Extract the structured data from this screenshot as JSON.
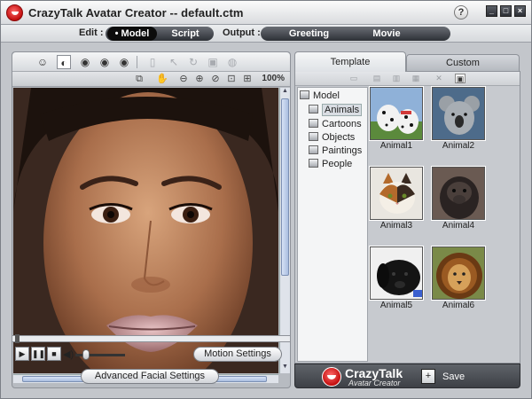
{
  "window": {
    "title": "CrazyTalk Avatar Creator -- default.ctm",
    "help": "?",
    "controls": [
      "_",
      "□",
      "×"
    ]
  },
  "modebar": {
    "edit_label": "Edit :",
    "output_label": "Output :",
    "edit_tabs": [
      "Model",
      "Script"
    ],
    "output_tabs": [
      "Greeting",
      "Movie"
    ],
    "active_tab": "Model"
  },
  "left_panel": {
    "zoom": "100%",
    "buttons": {
      "motion_settings": "Motion Settings",
      "advanced_facial_settings": "Advanced Facial Settings"
    }
  },
  "right_panel": {
    "tabs": [
      "Template",
      "Custom"
    ],
    "active_tab": "Template",
    "tree": {
      "root": "Model",
      "children": [
        "Animals",
        "Cartoons",
        "Objects",
        "Paintings",
        "People"
      ],
      "selected": "Animals"
    },
    "templates": [
      {
        "label": "Animal1",
        "icon": "dalmatians"
      },
      {
        "label": "Animal2",
        "icon": "koala"
      },
      {
        "label": "Animal3",
        "icon": "cat"
      },
      {
        "label": "Animal4",
        "icon": "gorilla"
      },
      {
        "label": "Animal5",
        "icon": "black-dog"
      },
      {
        "label": "Animal6",
        "icon": "lion"
      }
    ],
    "footer": {
      "brand": "CrazyTalk",
      "subtitle": "Avatar Creator",
      "save_label": "Save"
    }
  },
  "colors": {
    "accent_red": "#c20d0d",
    "panel_bg": "#c3c6cb",
    "footer_bg": "#3d4046"
  }
}
